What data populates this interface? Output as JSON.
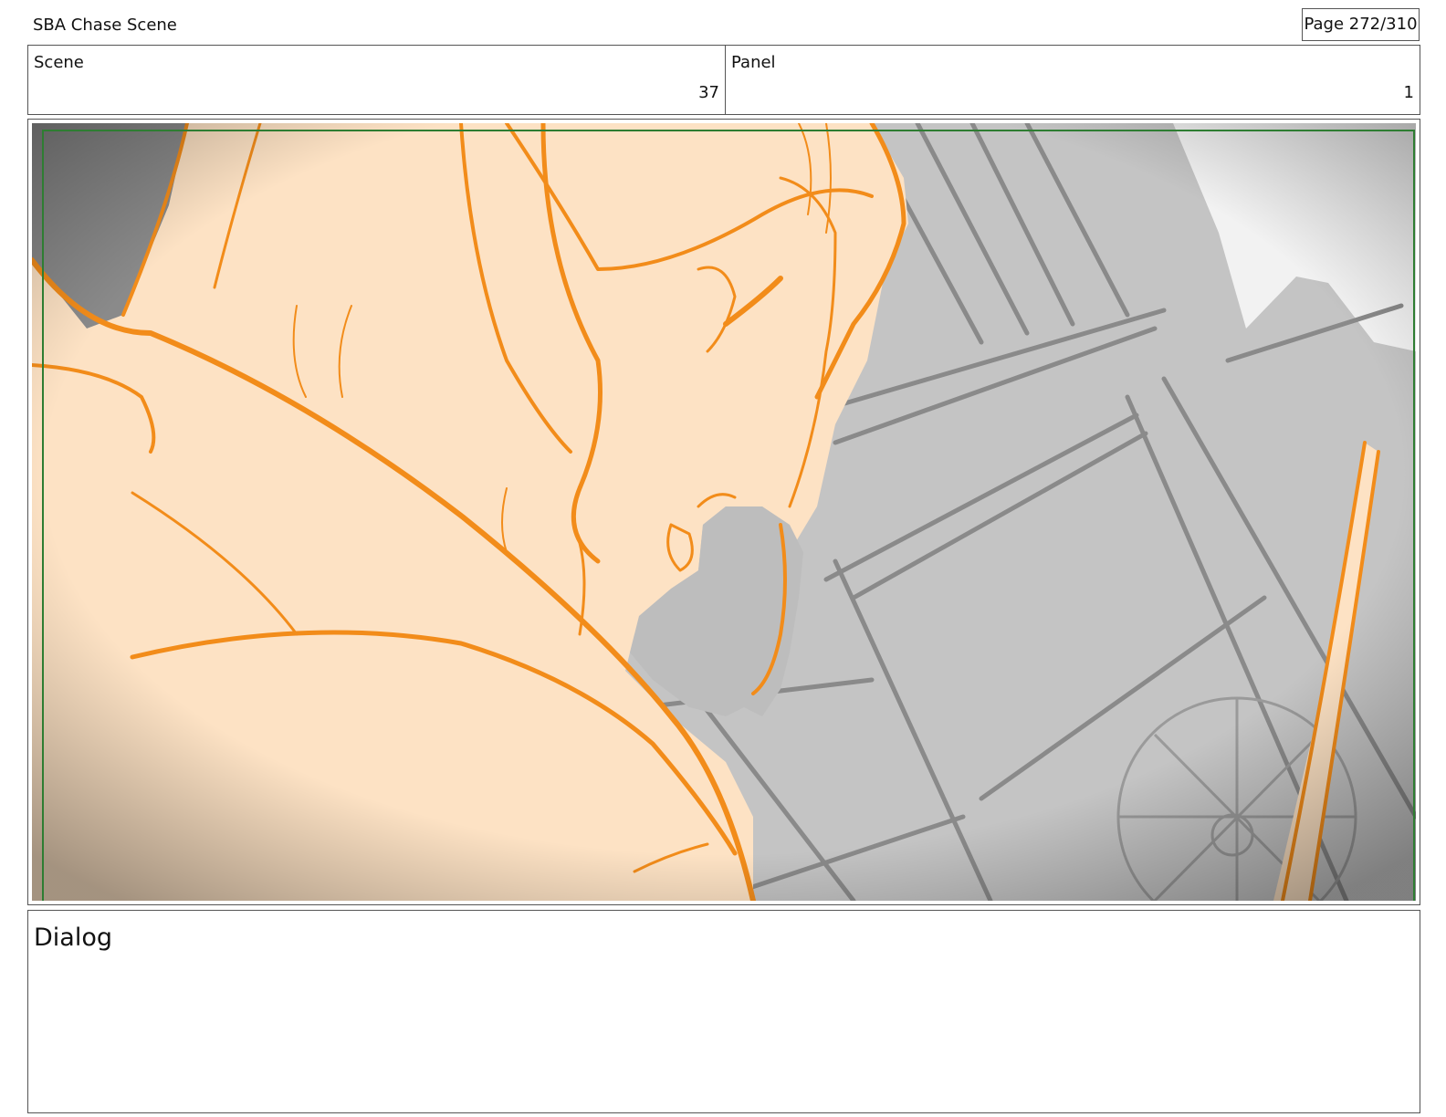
{
  "header": {
    "title": "SBA Chase Scene",
    "page_counter": "Page 272/310"
  },
  "info": {
    "scene_label": "Scene",
    "scene_value": "37",
    "panel_label": "Panel",
    "panel_value": "1"
  },
  "frame": {
    "skin_color": "#fde2c4",
    "line_color": "#f28c1a",
    "background_gray": "#c4c4c4",
    "safe_area_color": "#2e7d32"
  },
  "dialog": {
    "label": "Dialog"
  }
}
